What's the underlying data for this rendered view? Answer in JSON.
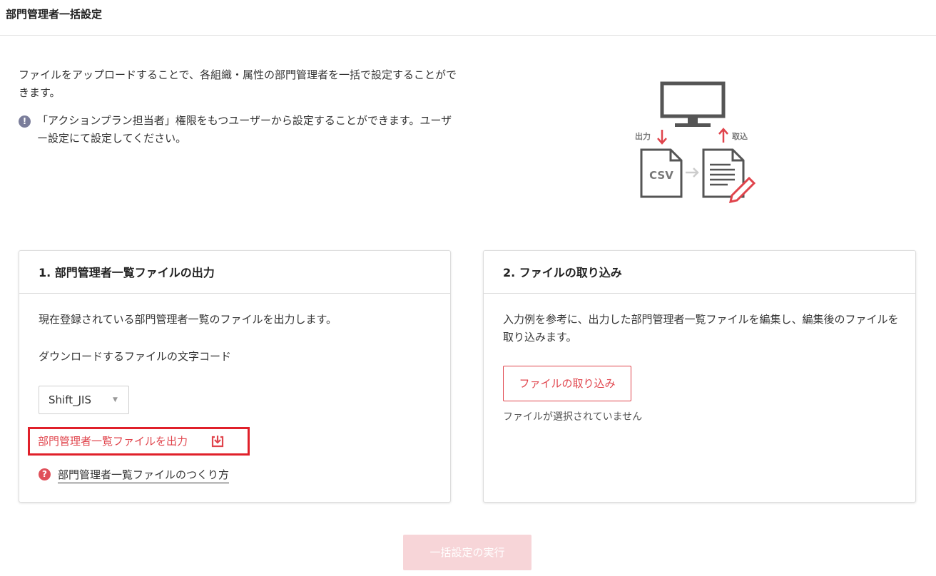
{
  "header": {
    "title": "部門管理者一括設定"
  },
  "intro": {
    "description": "ファイルをアップロードすることで、各組織・属性の部門管理者を一括で設定することができます。",
    "notice": "「アクションプラン担当者」権限をもつユーザーから設定することができます。ユーザー設定にて設定してください。",
    "notice_icon": "!"
  },
  "illustration": {
    "output_label": "出力",
    "import_label": "取込",
    "csv_label": "CSV"
  },
  "export_card": {
    "title": "1. 部門管理者一覧ファイルの出力",
    "description": "現在登録されている部門管理者一覧のファイルを出力します。",
    "encoding_label": "ダウンロードするファイルの文字コード",
    "encoding_selected": "Shift_JIS",
    "export_link": "部門管理者一覧ファイルを出力",
    "help_link": "部門管理者一覧ファイルのつくり方",
    "help_icon": "?"
  },
  "import_card": {
    "title": "2. ファイルの取り込み",
    "description": "入力例を参考に、出力した部門管理者一覧ファイルを編集し、編集後のファイルを取り込みます。",
    "import_button": "ファイルの取り込み",
    "file_status": "ファイルが選択されていません"
  },
  "footer": {
    "execute_button": "一括設定の実行"
  },
  "colors": {
    "accent": "#e0444c",
    "highlight_border": "#e0202a",
    "disabled_button": "#f7d5d8",
    "notice_icon": "#7a7d9a"
  }
}
